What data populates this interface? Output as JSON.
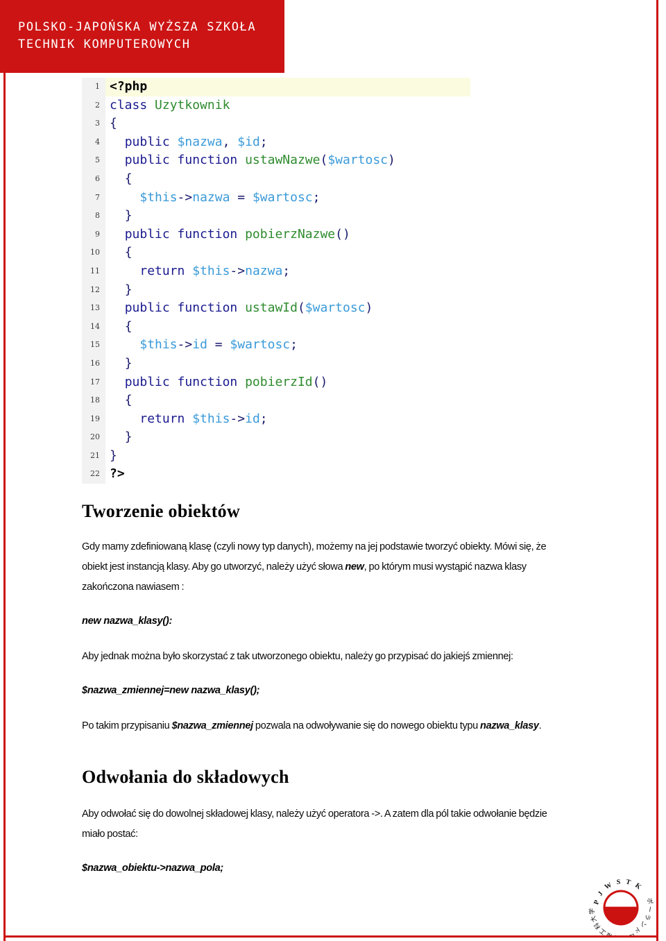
{
  "document": {
    "header_banner": {
      "institution_name": "POLSKO-JAPOŃSKA WYŻSZA SZKOŁA\nTECHNIK KOMPUTEROWYCH",
      "background_color": "#cc1414",
      "text_color": "#ffffff"
    },
    "frame_color": "#cc1111",
    "code_block": {
      "language": "php",
      "highlight_color": "#fbfbe0",
      "gutter_color": "#f2f2f2",
      "lines": [
        {
          "n": "1",
          "text": "<?php"
        },
        {
          "n": "2",
          "text": "class Uzytkownik"
        },
        {
          "n": "3",
          "text": "{"
        },
        {
          "n": "4",
          "text": "   public $nazwa, $id;"
        },
        {
          "n": "5",
          "text": "   public function ustawNazwe($wartosc)"
        },
        {
          "n": "6",
          "text": "   {"
        },
        {
          "n": "7",
          "text": "      $this->nazwa = $wartosc;"
        },
        {
          "n": "8",
          "text": "   }"
        },
        {
          "n": "9",
          "text": "   public function pobierzNazwe()"
        },
        {
          "n": "10",
          "text": "   {"
        },
        {
          "n": "11",
          "text": "      return $this->nazwa;"
        },
        {
          "n": "12",
          "text": "   }"
        },
        {
          "n": "13",
          "text": "   public function ustawId($wartosc)"
        },
        {
          "n": "14",
          "text": "   {"
        },
        {
          "n": "15",
          "text": "      $this->id = $wartosc;"
        },
        {
          "n": "16",
          "text": "   }"
        },
        {
          "n": "17",
          "text": "   public function pobierzId()"
        },
        {
          "n": "18",
          "text": "   {"
        },
        {
          "n": "19",
          "text": "      return $this->id;"
        },
        {
          "n": "20",
          "text": "   }"
        },
        {
          "n": "21",
          "text": "}"
        },
        {
          "n": "22",
          "text": "?>"
        }
      ]
    },
    "sections": [
      {
        "heading": "Tworzenie obiektów",
        "paragraph_1_a": "Gdy mamy zdefiniowaną klasę (czyli nowy typ danych), możemy na jej podstawie tworzyć obiekty. Mówi się, że obiekt jest instancją klasy. Aby go utworzyć, należy użyć słowa ",
        "paragraph_1_em": "new",
        "paragraph_1_b": ", po którym musi wystąpić  nazwa klasy zakończona nawiasem :",
        "code_snippet_1": "new nazwa_klasy():",
        "paragraph_2": "Aby jednak można było skorzystać z tak utworzonego obiektu, należy go przypisać do jakiejś zmiennej:",
        "code_snippet_2": "$nazwa_zmiennej=new nazwa_klasy();",
        "paragraph_3_a": "Po takim przypisaniu ",
        "paragraph_3_em1": "$nazwa_zmiennej",
        "paragraph_3_b": " pozwala na odwoływanie się do nowego obiektu typu ",
        "paragraph_3_em2": "nazwa_klasy",
        "paragraph_3_c": "."
      },
      {
        "heading": "Odwołania do składowych",
        "paragraph_1": "Aby odwołać się do dowolnej składowej klasy, należy użyć operatora ->. A zatem dla pól takie odwołanie będzie miało postać:",
        "code_snippet_1": "$nazwa_obiektu->nazwa_pola;"
      }
    ],
    "logo": {
      "name": "pjwstk-logo",
      "latin_text": "PJWSTK",
      "katakana_text": "ポーランド",
      "kanji_text": "日本情報工科大学",
      "ring_color": "#cc1111",
      "flag_top_color": "#ffffff",
      "flag_bottom_color": "#cc1111"
    }
  }
}
